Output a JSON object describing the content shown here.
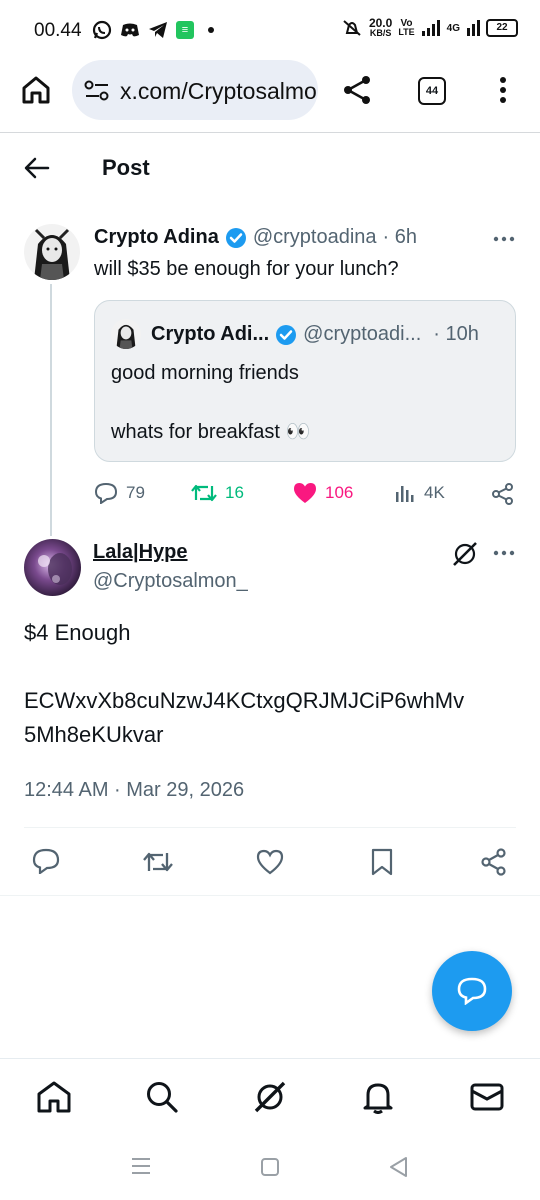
{
  "status_bar": {
    "time": "00.44",
    "net_speed_value": "20.0",
    "net_speed_unit": "KB/S",
    "volte_top": "Vo",
    "volte_bottom": "LTE",
    "network_label": "4G",
    "battery": "22"
  },
  "browser": {
    "url": "x.com/Cryptosalmon_",
    "tab_count": "44"
  },
  "header": {
    "title": "Post"
  },
  "parent_post": {
    "name": "Crypto Adina",
    "handle": "@cryptoadina",
    "time": "· 6h",
    "text": "will $35 be enough for your lunch?",
    "quote": {
      "name": "Crypto Adi...",
      "handle": "@cryptoadi...",
      "time": "· 10h",
      "line1": "good morning friends",
      "line2": "whats for breakfast 👀"
    },
    "stats": {
      "replies": "79",
      "reposts": "16",
      "likes": "106",
      "views": "4K"
    }
  },
  "main_post": {
    "name": "Lala|Hype",
    "handle": "@Cryptosalmon_",
    "line1": "$4 Enough",
    "line2": "ECWxvXb8cuNzwJ4KCtxgQRJMJCiP6whMv",
    "line3": "5Mh8eKUkvar",
    "timestamp": "12:44 AM · Mar 29, 2026"
  },
  "colors": {
    "accent": "#1d9bf0",
    "muted": "#536471",
    "repost": "#00ba7c",
    "like": "#f91880",
    "verified": "#1d9bf0"
  },
  "icons": {
    "nav": [
      "home-icon",
      "search-icon",
      "grok-icon",
      "bell-icon",
      "mail-icon"
    ]
  }
}
